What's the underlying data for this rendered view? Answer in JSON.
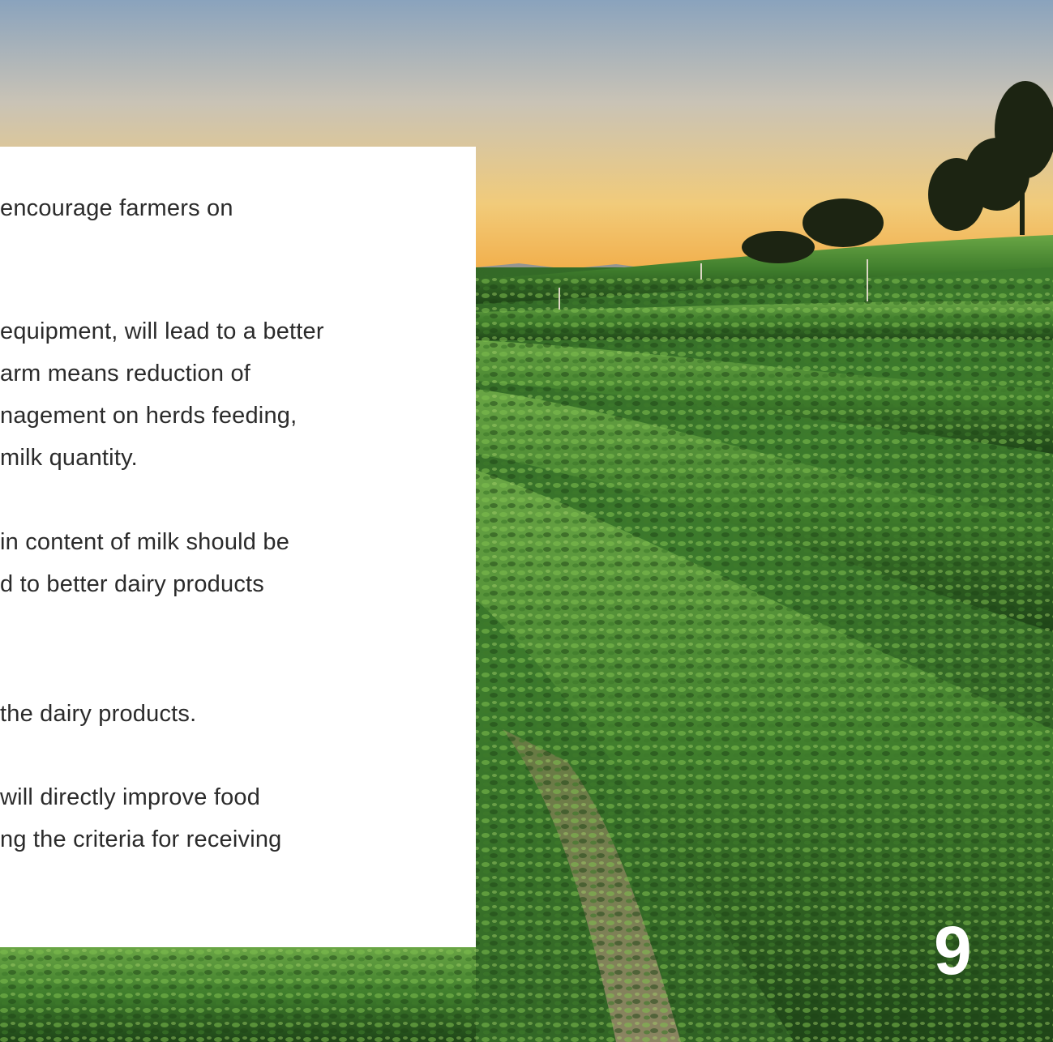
{
  "body": {
    "paragraphs": [
      [
        "encourage farmers on"
      ],
      [
        "equipment, will lead to a better",
        "arm means reduction of",
        "nagement on herds feeding,",
        " milk quantity."
      ],
      [
        "in content of milk should be",
        "d to better dairy products"
      ],
      [
        "the dairy products."
      ],
      [
        "will directly improve food",
        "ng the criteria for receiving"
      ]
    ]
  },
  "page_number": "9",
  "colors": {
    "panel": "#ffffff",
    "text": "#2b2b2b",
    "page_number": "#ffffff",
    "sky_top": "#8fa6bd",
    "sky_horizon": "#f2b24a",
    "foliage_dark": "#1f4a1a",
    "foliage_light": "#5f9b3c"
  },
  "photo": {
    "subject": "tea-plantation-at-sunset"
  }
}
